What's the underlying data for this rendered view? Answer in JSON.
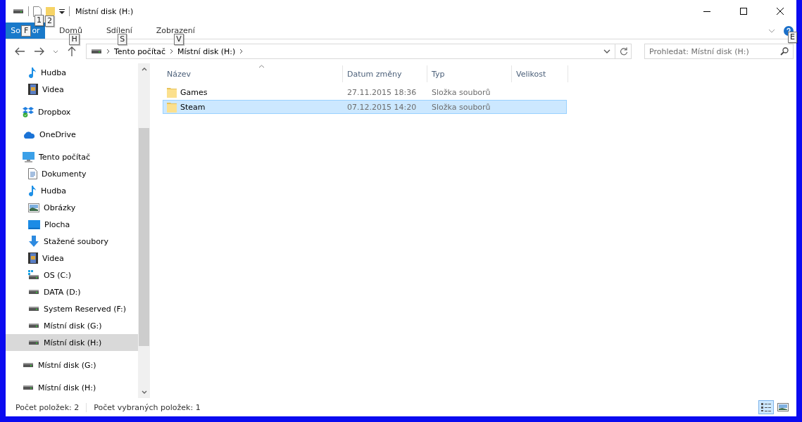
{
  "window": {
    "title": "Místní disk (H:)",
    "quick_access_tips": [
      "1",
      "2"
    ]
  },
  "ribbon": {
    "file_tab": {
      "label_start": "So",
      "label_end": "or",
      "key_tip": "F"
    },
    "tabs": [
      {
        "label": "Domů",
        "key_tip": "H"
      },
      {
        "label": "Sdílení",
        "key_tip": "S"
      },
      {
        "label": "Zobrazení",
        "key_tip": "V"
      }
    ],
    "help_key_tip": "E"
  },
  "address": {
    "path": [
      "Tento počítač",
      "Místní disk (H:)"
    ]
  },
  "search": {
    "placeholder": "Prohledat: Místní disk (H:)"
  },
  "sidebar": {
    "scrolled_children": [
      {
        "label": "Hudba",
        "kind": "music",
        "selected": false
      },
      {
        "label": "Videa",
        "kind": "video",
        "selected": false
      }
    ],
    "items": [
      {
        "label": "Dropbox",
        "kind": "dropbox",
        "selected": false
      },
      {
        "label": "OneDrive",
        "kind": "onedrive",
        "selected": false
      },
      {
        "label": "Tento počítač",
        "kind": "pc",
        "selected": false,
        "children": [
          {
            "label": "Dokumenty",
            "kind": "documents",
            "selected": false
          },
          {
            "label": "Hudba",
            "kind": "music",
            "selected": false
          },
          {
            "label": "Obrázky",
            "kind": "pictures",
            "selected": false
          },
          {
            "label": "Plocha",
            "kind": "desktop",
            "selected": false
          },
          {
            "label": "Stažené soubory",
            "kind": "downloads",
            "selected": false
          },
          {
            "label": "Videa",
            "kind": "video",
            "selected": false
          },
          {
            "label": "OS (C:)",
            "kind": "os-drive",
            "selected": false
          },
          {
            "label": "DATA (D:)",
            "kind": "drive",
            "selected": false
          },
          {
            "label": "System Reserved (F:)",
            "kind": "drive",
            "selected": false
          },
          {
            "label": "Místní disk (G:)",
            "kind": "drive",
            "selected": false
          },
          {
            "label": "Místní disk (H:)",
            "kind": "drive",
            "selected": true
          }
        ]
      },
      {
        "label": "Místní disk (G:)",
        "kind": "drive",
        "selected": false
      },
      {
        "label": "Místní disk (H:)",
        "kind": "drive",
        "selected": false
      }
    ]
  },
  "table": {
    "columns": [
      "Název",
      "Datum změny",
      "Typ",
      "Velikost"
    ],
    "rows": [
      {
        "name": "Games",
        "date": "27.11.2015 18:36",
        "type": "Složka souborů",
        "selected": false
      },
      {
        "name": "Steam",
        "date": "07.12.2015 14:20",
        "type": "Složka souborů",
        "selected": true
      }
    ]
  },
  "status_bar": {
    "items": [
      "Počet položek: 2",
      "Počet vybraných položek: 1"
    ],
    "views": [
      {
        "kind": "details",
        "selected": true
      },
      {
        "kind": "large-icons",
        "selected": false
      }
    ]
  }
}
